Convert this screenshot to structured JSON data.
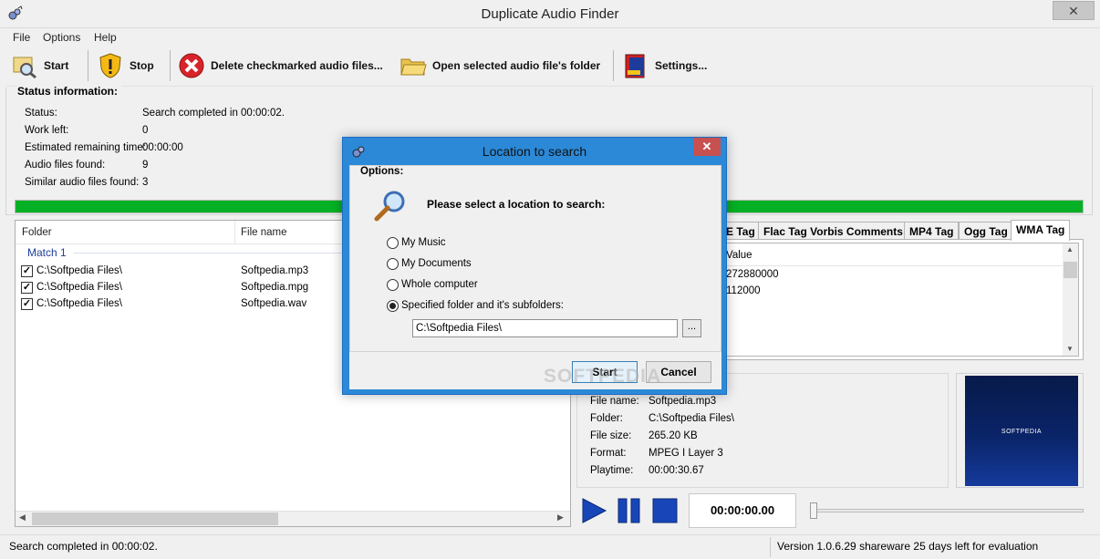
{
  "window": {
    "title": "Duplicate Audio Finder",
    "close_glyph": "✕"
  },
  "menu": [
    "File",
    "Options",
    "Help"
  ],
  "toolbar": {
    "start": "Start",
    "stop": "Stop",
    "delete": "Delete checkmarked audio files...",
    "open_folder": "Open selected audio file's folder",
    "settings": "Settings..."
  },
  "status": {
    "group_title": "Status information:",
    "rows": [
      {
        "label": "Status:",
        "value": "Search completed in 00:00:02."
      },
      {
        "label": "Work left:",
        "value": "0"
      },
      {
        "label": "Estimated remaining time:",
        "value": "00:00:00"
      },
      {
        "label": "Audio files found:",
        "value": "9"
      },
      {
        "label": "Similar audio files found:",
        "value": "3"
      }
    ],
    "progress": 1.0
  },
  "results": {
    "columns": [
      "Folder",
      "File name"
    ],
    "match_label": "Match 1",
    "rows": [
      {
        "checked": true,
        "folder": "C:\\Softpedia Files\\",
        "file": "Softpedia.mp3"
      },
      {
        "checked": true,
        "folder": "C:\\Softpedia Files\\",
        "file": "Softpedia.mpg"
      },
      {
        "checked": true,
        "folder": "C:\\Softpedia Files\\",
        "file": "Softpedia.wav"
      }
    ]
  },
  "tags": {
    "tabs": [
      "E Tag",
      "Flac Tag Vorbis Comments",
      "MP4 Tag",
      "Ogg Tag",
      "WMA Tag"
    ],
    "active": "WMA Tag",
    "value_header": "Value",
    "values": [
      "272880000",
      "112000"
    ]
  },
  "file_info": {
    "rows": [
      {
        "label": "File name:",
        "value": "Softpedia.mp3"
      },
      {
        "label": "Folder:",
        "value": "C:\\Softpedia Files\\"
      },
      {
        "label": "File size:",
        "value": "265.20 KB"
      },
      {
        "label": "Format:",
        "value": "MPEG I Layer 3"
      },
      {
        "label": "Playtime:",
        "value": "00:00:30.67"
      }
    ],
    "art_text": "SOFTPEDIA"
  },
  "player": {
    "time": "00:00:00.00",
    "seek": 0
  },
  "statusbar": {
    "left": "Search completed in 00:00:02.",
    "right": "Version 1.0.6.29 shareware 25 days left for evaluation"
  },
  "watermark": "SOFTPEDIA",
  "dialog": {
    "title": "Location to search",
    "options_label": "Options:",
    "prompt": "Please select a location to search:",
    "choices": [
      {
        "label": "My Music",
        "selected": false
      },
      {
        "label": "My Documents",
        "selected": false
      },
      {
        "label": "Whole computer",
        "selected": false
      },
      {
        "label": "Specified folder and it's subfolders:",
        "selected": true
      }
    ],
    "path": "C:\\Softpedia Files\\",
    "browse": "...",
    "start": "Start",
    "cancel": "Cancel"
  },
  "colors": {
    "progress": "#06b025",
    "player_blue": "#1846b8",
    "match_text": "#1e3f9a"
  }
}
